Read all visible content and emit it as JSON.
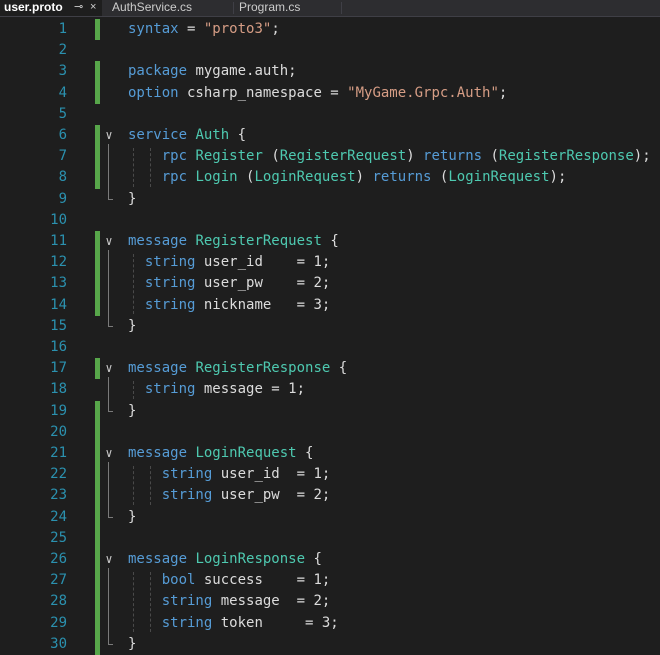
{
  "tabs": [
    {
      "label": "user.proto",
      "active": true,
      "pin_icon": "⊸",
      "close_icon": "×"
    },
    {
      "label": "AuthService.cs",
      "active": false
    },
    {
      "label": "Program.cs",
      "active": false
    }
  ],
  "editor": {
    "language": "protobuf",
    "colors": {
      "keyword": "#569cd6",
      "type": "#4ec9b0",
      "string": "#d69d85",
      "plain": "#dcdcdc",
      "line_number": "#2b91af",
      "change_bar": "#57a64a",
      "background": "#1e1e1e"
    },
    "lines": [
      {
        "n": "1",
        "tokens": [
          [
            "kw",
            "syntax"
          ],
          [
            "p",
            " = "
          ],
          [
            "str",
            "\"proto3\""
          ],
          [
            "p",
            ";"
          ]
        ]
      },
      {
        "n": "2",
        "tokens": []
      },
      {
        "n": "3",
        "tokens": [
          [
            "kw",
            "package"
          ],
          [
            "p",
            " mygame.auth;"
          ]
        ]
      },
      {
        "n": "4",
        "tokens": [
          [
            "kw",
            "option"
          ],
          [
            "p",
            " csharp_namespace = "
          ],
          [
            "str",
            "\"MyGame.Grpc.Auth\""
          ],
          [
            "p",
            ";"
          ]
        ]
      },
      {
        "n": "5",
        "tokens": []
      },
      {
        "n": "6",
        "fold": "open",
        "tokens": [
          [
            "kw",
            "service"
          ],
          [
            "p",
            " "
          ],
          [
            "type",
            "Auth"
          ],
          [
            "p",
            " {"
          ]
        ]
      },
      {
        "n": "7",
        "tokens": [
          [
            "p",
            "    "
          ],
          [
            "kw",
            "rpc"
          ],
          [
            "p",
            " "
          ],
          [
            "type",
            "Register"
          ],
          [
            "p",
            " ("
          ],
          [
            "type",
            "RegisterRequest"
          ],
          [
            "p",
            ") "
          ],
          [
            "kw",
            "returns"
          ],
          [
            "p",
            " ("
          ],
          [
            "type",
            "RegisterResponse"
          ],
          [
            "p",
            ");"
          ]
        ]
      },
      {
        "n": "8",
        "tokens": [
          [
            "p",
            "    "
          ],
          [
            "kw",
            "rpc"
          ],
          [
            "p",
            " "
          ],
          [
            "type",
            "Login"
          ],
          [
            "p",
            " ("
          ],
          [
            "type",
            "LoginRequest"
          ],
          [
            "p",
            ") "
          ],
          [
            "kw",
            "returns"
          ],
          [
            "p",
            " ("
          ],
          [
            "type",
            "LoginRequest"
          ],
          [
            "p",
            ");"
          ]
        ]
      },
      {
        "n": "9",
        "tokens": [
          [
            "p",
            "}"
          ]
        ]
      },
      {
        "n": "10",
        "tokens": []
      },
      {
        "n": "11",
        "fold": "open",
        "tokens": [
          [
            "kw",
            "message"
          ],
          [
            "p",
            " "
          ],
          [
            "type",
            "RegisterRequest"
          ],
          [
            "p",
            " {"
          ]
        ]
      },
      {
        "n": "12",
        "tokens": [
          [
            "p",
            "  "
          ],
          [
            "kw",
            "string"
          ],
          [
            "p",
            " user_id    = 1;"
          ]
        ]
      },
      {
        "n": "13",
        "tokens": [
          [
            "p",
            "  "
          ],
          [
            "kw",
            "string"
          ],
          [
            "p",
            " user_pw    = 2;"
          ]
        ]
      },
      {
        "n": "14",
        "tokens": [
          [
            "p",
            "  "
          ],
          [
            "kw",
            "string"
          ],
          [
            "p",
            " nickname   = 3;"
          ]
        ]
      },
      {
        "n": "15",
        "tokens": [
          [
            "p",
            "}"
          ]
        ]
      },
      {
        "n": "16",
        "tokens": []
      },
      {
        "n": "17",
        "fold": "open",
        "tokens": [
          [
            "kw",
            "message"
          ],
          [
            "p",
            " "
          ],
          [
            "type",
            "RegisterResponse"
          ],
          [
            "p",
            " {"
          ]
        ]
      },
      {
        "n": "18",
        "tokens": [
          [
            "p",
            "  "
          ],
          [
            "kw",
            "string"
          ],
          [
            "p",
            " message = 1;"
          ]
        ]
      },
      {
        "n": "19",
        "tokens": [
          [
            "p",
            "}"
          ]
        ]
      },
      {
        "n": "20",
        "tokens": []
      },
      {
        "n": "21",
        "fold": "open",
        "tokens": [
          [
            "kw",
            "message"
          ],
          [
            "p",
            " "
          ],
          [
            "type",
            "LoginRequest"
          ],
          [
            "p",
            " {"
          ]
        ]
      },
      {
        "n": "22",
        "tokens": [
          [
            "p",
            "    "
          ],
          [
            "kw",
            "string"
          ],
          [
            "p",
            " user_id  = 1;"
          ]
        ]
      },
      {
        "n": "23",
        "tokens": [
          [
            "p",
            "    "
          ],
          [
            "kw",
            "string"
          ],
          [
            "p",
            " user_pw  = 2;"
          ]
        ]
      },
      {
        "n": "24",
        "tokens": [
          [
            "p",
            "}"
          ]
        ]
      },
      {
        "n": "25",
        "tokens": []
      },
      {
        "n": "26",
        "fold": "open",
        "tokens": [
          [
            "kw",
            "message"
          ],
          [
            "p",
            " "
          ],
          [
            "type",
            "LoginResponse"
          ],
          [
            "p",
            " {"
          ]
        ]
      },
      {
        "n": "27",
        "tokens": [
          [
            "p",
            "    "
          ],
          [
            "kw",
            "bool"
          ],
          [
            "p",
            " success    = 1;"
          ]
        ]
      },
      {
        "n": "28",
        "tokens": [
          [
            "p",
            "    "
          ],
          [
            "kw",
            "string"
          ],
          [
            "p",
            " message  = 2;"
          ]
        ]
      },
      {
        "n": "29",
        "tokens": [
          [
            "p",
            "    "
          ],
          [
            "kw",
            "string"
          ],
          [
            "p",
            " token     = 3;"
          ]
        ]
      },
      {
        "n": "30",
        "tokens": [
          [
            "p",
            "}"
          ]
        ]
      }
    ]
  }
}
